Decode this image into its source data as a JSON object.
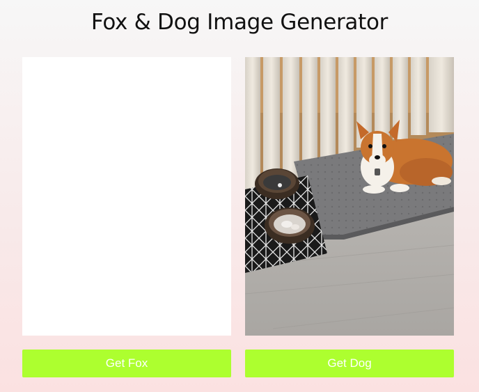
{
  "page": {
    "title": "Fox & Dog Image Generator"
  },
  "fox_panel": {
    "button_label": "Get Fox",
    "image_loaded": false
  },
  "dog_panel": {
    "button_label": "Get Dog",
    "image_loaded": true,
    "image_subject": "corgi dog lying on a mat beside food and water bowls"
  },
  "colors": {
    "button_bg": "#adff2f",
    "button_text": "#ffffff",
    "panel_bg": "#ffffff"
  }
}
